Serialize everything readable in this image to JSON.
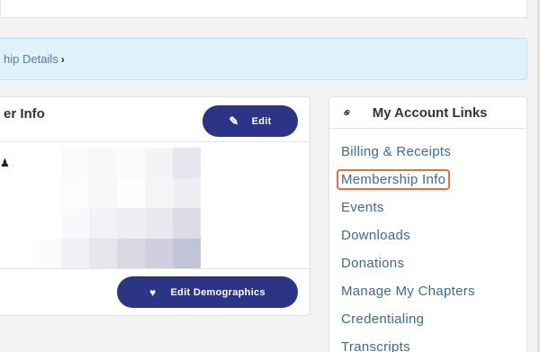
{
  "banner": {
    "link_text": "hip Details",
    "chevron": "›"
  },
  "card": {
    "title": "er Info",
    "edit_label": "Edit",
    "edit_icon": "pencil-icon",
    "demographics_label": "Edit Demographics",
    "demographics_icon": "heart-icon",
    "person_icon": "user-icon"
  },
  "sidebar": {
    "title": "My Account Links",
    "icon": "link-icon",
    "items": [
      {
        "label": "Billing & Receipts"
      },
      {
        "label": "Membership Info",
        "highlighted": true
      },
      {
        "label": "Events"
      },
      {
        "label": "Downloads"
      },
      {
        "label": "Donations"
      },
      {
        "label": "Manage My Chapters"
      },
      {
        "label": "Credentialing"
      },
      {
        "label": "Transcripts"
      }
    ]
  },
  "colors": {
    "button": "#2c3585",
    "link": "#3c6a94",
    "banner_bg": "#dff1f9",
    "highlight": "#e86e3a"
  }
}
